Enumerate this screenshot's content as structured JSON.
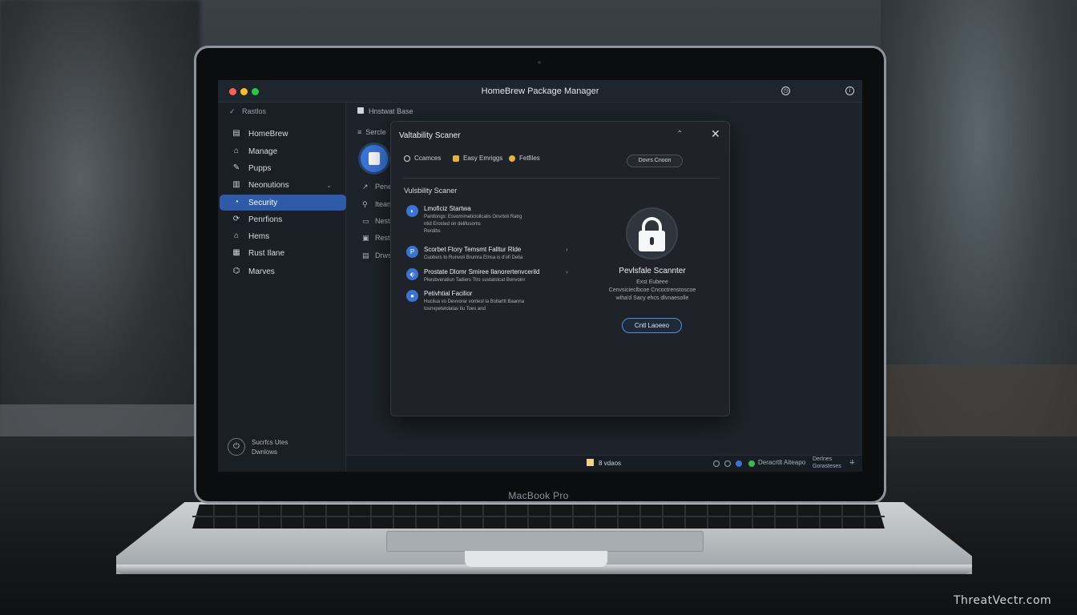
{
  "window": {
    "title": "HomeBrew Package Manager"
  },
  "sidebar": {
    "header": "Rastlos",
    "items": [
      {
        "label": "HomeBrew",
        "icon": "home-icon"
      },
      {
        "label": "Manage",
        "icon": "home-outline-icon"
      },
      {
        "label": "Pupps",
        "icon": "edit-icon"
      },
      {
        "label": "Neonutions",
        "icon": "document-icon"
      },
      {
        "label": "Security",
        "icon": "shield-icon"
      },
      {
        "label": "Penrfions",
        "icon": "refresh-icon"
      },
      {
        "label": "Hems",
        "icon": "house-icon"
      },
      {
        "label": "Rust Ilane",
        "icon": "grid-icon"
      },
      {
        "label": "Marves",
        "icon": "tag-icon"
      }
    ],
    "footer": {
      "line1": "Sucrfcs Utes",
      "line2": "Dwnlows"
    }
  },
  "content": {
    "breadcrumb": "Hnstwat Base",
    "subheader": "Sercle",
    "rows": [
      "Penet",
      "Itean",
      "Nest",
      "Resta",
      "Drws"
    ]
  },
  "dialog": {
    "title": "Valtability Scaner",
    "tabs": [
      "Ccamces",
      "Easy Emriggs",
      "Fetfiles"
    ],
    "button": "Dovrs Cnoon",
    "section": "Vulsbility Scaner",
    "items": [
      {
        "title": "Lmoficiz Startwa",
        "desc": [
          "Pantlongs: Esvomimeticiollcatis Onvrtoli Ratrg",
          "ntid Erosted on delifusoms",
          "Rerdibs"
        ]
      },
      {
        "title": "Scorbet Ftory Temsmt Falltur Rlde",
        "desc": [
          "Cuobers to Runvoli Brumra Etnsa is d'ofi Delia"
        ]
      },
      {
        "title": "Prostate Dlomr Smiree Ilanorertenvcerild",
        "desc": [
          "Pkesbveratiun Tadiers Ttrs sustatstcat Bonvoinr"
        ]
      },
      {
        "title": "Petivhtial Facilior",
        "desc": [
          "Huciiua vo Devvorar vontesl la Bollarttl Baanna",
          "tosnvpetelolalas tiu Toes and"
        ]
      }
    ],
    "panel": {
      "title": "Pevlsfale Scannter",
      "lines": [
        "Exst Eubeee",
        "Cenvsicieclbcoe Cncoctrenstoscoe",
        "wiha'd Sacy ehcs dlvnaesolle"
      ],
      "button": "Cntl Laoeeo"
    }
  },
  "statusbar": {
    "middle": "8 vdaos",
    "right": "Deracrtlt Aiteapo",
    "right2_1": "Derlnes",
    "right2_2": "Gorasteses"
  },
  "device": {
    "brand": "MacBook Pro"
  },
  "watermark": "ThreatVectr.com",
  "colors": {
    "accent": "#2f5aa8",
    "icon_blue": "#3b73d1"
  }
}
